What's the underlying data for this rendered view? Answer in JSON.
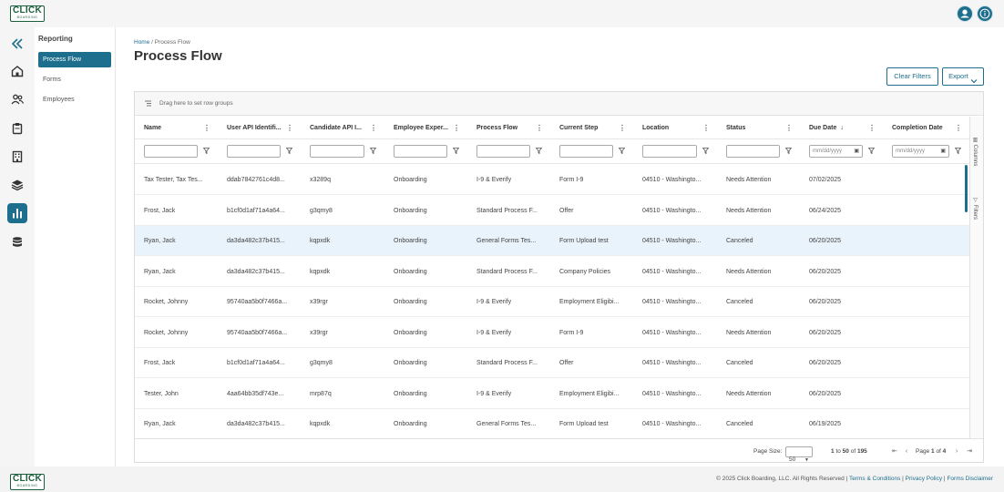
{
  "brand": {
    "logo_text": "CLICK",
    "logo_sub": "BOARDING",
    "color": "#1e6f8e"
  },
  "topbar": {
    "icons": [
      "user-icon",
      "info-icon"
    ]
  },
  "rail": {
    "icons": [
      "collapse-icon",
      "home-icon",
      "people-icon",
      "clipboard-icon",
      "building-icon",
      "layers-icon",
      "chart-icon",
      "database-icon"
    ],
    "active": "chart-icon"
  },
  "subnav": {
    "title": "Reporting",
    "items": [
      {
        "label": "Process Flow",
        "active": true
      },
      {
        "label": "Forms",
        "active": false
      },
      {
        "label": "Employees",
        "active": false
      }
    ]
  },
  "breadcrumb": {
    "home": "Home",
    "sep": " / ",
    "current": "Process Flow"
  },
  "page_title": "Process Flow",
  "buttons": {
    "clear_filters": "Clear Filters",
    "export": "Export"
  },
  "grid": {
    "group_hint": "Drag here to set row groups",
    "columns": [
      "Name",
      "User API Identifi...",
      "Candidate API I...",
      "Employee Exper...",
      "Process Flow",
      "Current Step",
      "Location",
      "Status",
      "Due Date",
      "Completion Date"
    ],
    "sort_indicator": "↓",
    "date_placeholder": "mm/dd/yyyy",
    "rows": [
      [
        "Tax Tester, Tax Tes...",
        "ddab7842761c4d8...",
        "x3289q",
        "Onboarding",
        "I-9 & Everify",
        "Form I-9",
        "04510 - Washingto...",
        "Needs Attention",
        "07/02/2025",
        ""
      ],
      [
        "Frost, Jack",
        "b1cf0d1af71a4a64...",
        "g3qmy8",
        "Onboarding",
        "Standard Process F...",
        "Offer",
        "04510 - Washingto...",
        "Needs Attention",
        "06/24/2025",
        ""
      ],
      [
        "Ryan, Jack",
        "da3da482c37b415...",
        "kqpxdk",
        "Onboarding",
        "General Forms Tes...",
        "Form Upload test",
        "04510 - Washingto...",
        "Canceled",
        "06/20/2025",
        ""
      ],
      [
        "Ryan, Jack",
        "da3da482c37b415...",
        "kqpxdk",
        "Onboarding",
        "Standard Process F...",
        "Company Policies",
        "04510 - Washingto...",
        "Needs Attention",
        "06/20/2025",
        ""
      ],
      [
        "Rocket, Johnny",
        "95740aa5b0f7466a...",
        "x39rgr",
        "Onboarding",
        "I-9 & Everify",
        "Employment Eligibi...",
        "04510 - Washingto...",
        "Canceled",
        "06/20/2025",
        ""
      ],
      [
        "Rocket, Johnny",
        "95740aa5b0f7466a...",
        "x39rgr",
        "Onboarding",
        "I-9 & Everify",
        "Form I-9",
        "04510 - Washingto...",
        "Needs Attention",
        "06/20/2025",
        ""
      ],
      [
        "Frost, Jack",
        "b1cf0d1af71a4a64...",
        "g3qmy8",
        "Onboarding",
        "Standard Process F...",
        "Offer",
        "04510 - Washingto...",
        "Canceled",
        "06/20/2025",
        ""
      ],
      [
        "Tester, John",
        "4aa64bb35df743e...",
        "mrp87q",
        "Onboarding",
        "I-9 & Everify",
        "Employment Eligibi...",
        "04510 - Washingto...",
        "Needs Attention",
        "06/20/2025",
        ""
      ],
      [
        "Ryan, Jack",
        "da3da482c37b415...",
        "kqpxdk",
        "Onboarding",
        "General Forms Tes...",
        "Form Upload test",
        "04510 - Washingto...",
        "Canceled",
        "06/19/2025",
        ""
      ]
    ],
    "side_tools": [
      "Columns",
      "Filters"
    ]
  },
  "pager": {
    "page_size_label": "Page Size:",
    "page_size": "50",
    "range_from": "1",
    "range_to": "50",
    "of": "of",
    "total": "195",
    "to": "to",
    "page_label": "Page",
    "page": "1",
    "pages": "4"
  },
  "footer": {
    "copyright": "© 2025 Click Boarding, LLC. All Rights Reserved",
    "links": [
      "Terms & Conditions",
      "Privacy Policy",
      "Forms Disclaimer"
    ]
  }
}
